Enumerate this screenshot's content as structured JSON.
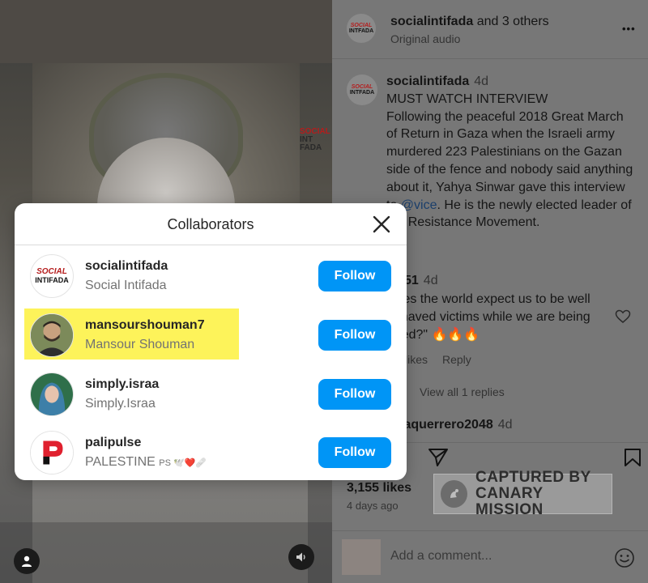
{
  "video": {
    "watermark_line1": "SOCIAL",
    "watermark_line2": "INT",
    "watermark_line3": "FADA"
  },
  "post_header": {
    "title_user": "socialintifada",
    "title_rest": " and 3 others",
    "subtitle": "Original audio",
    "more_label": "•••"
  },
  "caption": {
    "username": "socialintifada",
    "time": "4d",
    "line1": "MUST WATCH INTERVIEW",
    "text_before_mention": "Following the peaceful 2018 Great March of Return in Gaza when the Israeli army murdered 223 Palestinians on the Gazan side of the fence and nobody said anything about it, Yahya Sinwar gave this interview to ",
    "mention": "@vice",
    "text_after_mention": ". He is the newly elected leader of the Resistance Movement."
  },
  "comment1": {
    "username_visible": "51",
    "time": "4d",
    "text_line1": "Does the world expect us to be well",
    "text_line2": "behaved victims while we are being",
    "text_line3": "killed?\" 🔥🔥🔥",
    "likes_label": "likes",
    "reply_label": "Reply",
    "view_replies": "View all 1 replies"
  },
  "comment2": {
    "username_visible": "jaquerrero2048",
    "time": "4d"
  },
  "stats": {
    "likes": "3,155 likes",
    "date": "4 days ago"
  },
  "captured": {
    "line1": "CAPTURED BY",
    "line2": "CANARY MISSION"
  },
  "comment_input": {
    "placeholder": "Add a comment..."
  },
  "modal": {
    "title": "Collaborators",
    "follow_label": "Follow",
    "collaborators": [
      {
        "handle": "socialintifada",
        "name": "Social Intifada",
        "logo_line1": "SOCIAL",
        "logo_line2": "INTIFADA"
      },
      {
        "handle": "mansourshouman7",
        "name": "Mansour Shouman",
        "highlighted": true
      },
      {
        "handle": "simply.israa",
        "name": "Simply.Israa"
      },
      {
        "handle": "palipulse",
        "name": "PALESTINE",
        "name_suffix": "PS 🕊️❤️🩹"
      }
    ]
  },
  "colors": {
    "follow_blue": "#0095f6",
    "highlight_yellow": "#fdf35a",
    "logo_red": "#b51c1c"
  }
}
